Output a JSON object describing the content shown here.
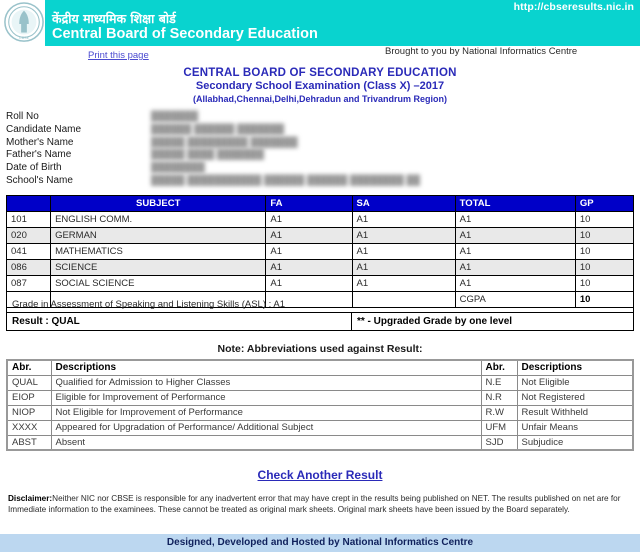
{
  "header": {
    "url": "http://cbseresults.nic.in",
    "hindi_title": "केंद्रीय माध्यमिक शिक्षा बोर्ड",
    "english_title": "Central Board of Secondary Education",
    "logo_icon": "cbse-emblem-icon",
    "print_link": "Print this page",
    "brought_by": "Brought to you by National Informatics Centre"
  },
  "title": {
    "line1": "CENTRAL BOARD OF SECONDARY EDUCATION",
    "line2": "Secondary School Examination (Class X) –2017",
    "line3": "(Allabhad,Chennai,Delhi,Dehradun and Trivandrum Region)",
    "color": "#2a2ab8"
  },
  "candidate": {
    "fields": [
      {
        "label": "Roll No",
        "value": "███████"
      },
      {
        "label": "Candidate Name",
        "value": "██████ ██████ ███████"
      },
      {
        "label": "Mother's Name",
        "value": "█████ █████████ ███████"
      },
      {
        "label": "Father's Name",
        "value": "█████ ████ ███████"
      },
      {
        "label": "Date of Birth",
        "value": "████████"
      },
      {
        "label": "School's Name",
        "value": "█████ ███████████ ██████ ██████ ████████ ██"
      }
    ]
  },
  "marks_table": {
    "headers": [
      "",
      "SUBJECT",
      "FA",
      "SA",
      "TOTAL",
      "GP"
    ],
    "header_bg": "#0000c8",
    "rows": [
      {
        "code": "101",
        "subject": "ENGLISH COMM.",
        "fa": "A1",
        "sa": "A1",
        "total": "A1",
        "gp": "10"
      },
      {
        "code": "020",
        "subject": "GERMAN",
        "fa": "A1",
        "sa": "A1",
        "total": "A1",
        "gp": "10"
      },
      {
        "code": "041",
        "subject": "MATHEMATICS",
        "fa": "A1",
        "sa": "A1",
        "total": "A1",
        "gp": "10"
      },
      {
        "code": "086",
        "subject": "SCIENCE",
        "fa": "A1",
        "sa": "A1",
        "total": "A1",
        "gp": "10"
      },
      {
        "code": "087",
        "subject": "SOCIAL SCIENCE",
        "fa": "A1",
        "sa": "A1",
        "total": "A1",
        "gp": "10"
      }
    ],
    "cgpa_label": "CGPA",
    "cgpa_value": "10"
  },
  "asl_text": "Grade in Assessment of Speaking and Listening Skills (ASL) : A1",
  "result": {
    "label": "Result : QUAL",
    "upgraded_note": "** - Upgraded Grade by one level"
  },
  "abbreviations": {
    "note": "Note: Abbreviations used against Result:",
    "headers": [
      "Abr.",
      "Descriptions",
      "Abr.",
      "Descriptions"
    ],
    "rows": [
      {
        "a1": "QUAL",
        "d1": "Qualified for Admission to Higher Classes",
        "a2": "N.E",
        "d2": "Not Eligible"
      },
      {
        "a1": "EIOP",
        "d1": "Eligible for Improvement of Performance",
        "a2": "N.R",
        "d2": "Not Registered"
      },
      {
        "a1": "NIOP",
        "d1": "Not Eligible for Improvement of Performance",
        "a2": "R.W",
        "d2": "Result Withheld"
      },
      {
        "a1": "XXXX",
        "d1": "Appeared for Upgradation of Performance/ Additional Subject",
        "a2": "UFM",
        "d2": "Unfair Means"
      },
      {
        "a1": "ABST",
        "d1": "Absent",
        "a2": "SJD",
        "d2": "Subjudice"
      }
    ]
  },
  "footer": {
    "check_another": "Check Another Result",
    "disclaimer_label": "Disclaimer:",
    "disclaimer_text": "Neither NIC nor CBSE is responsible for any inadvertent error that may have crept in the results being published on NET. The results published on net are for Immediate information to the examinees. These cannot be treated as original mark sheets. Original mark sheets have been issued by the Board separately.",
    "hosted_by": "Designed, Developed and Hosted by National Informatics Centre"
  }
}
